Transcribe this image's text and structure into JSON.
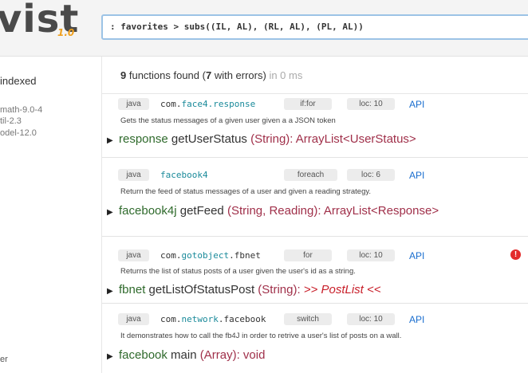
{
  "app": {
    "logo_text": "vist",
    "version": "1.0"
  },
  "query": {
    "value": ": favorites > subs((IL, AL), (RL, AL), (PL, AL))"
  },
  "sidebar": {
    "title": "indexed",
    "libraries": [
      "math-9.0-4",
      "til-2.3",
      "odel-12.0"
    ],
    "footer": "er"
  },
  "summary": {
    "count": "9",
    "text_a": " functions found (",
    "errors": "7",
    "text_b": " with errors)",
    "time": " in 0 ms"
  },
  "results": [
    {
      "lang": "java",
      "pkg_prefix": "com.",
      "pkg_hl": "face4.response",
      "pkg_suffix": "",
      "tag": "if:for",
      "loc": "loc: 10",
      "api": "API",
      "description": "Gets the status messages of a given user given a a JSON token",
      "sig_return": "response",
      "sig_name": " getUserStatus ",
      "sig_params": "(String): ArrayList<UserStatus>",
      "sig_error": "",
      "has_error": false
    },
    {
      "lang": "java",
      "pkg_prefix": "",
      "pkg_hl": "facebook4",
      "pkg_suffix": "",
      "tag": "foreach",
      "loc": "loc: 6",
      "api": "API",
      "description": "Return the feed of status messages of a user and given a reading strategy.",
      "sig_return": "facebook4j",
      "sig_name": " getFeed ",
      "sig_params": "(String, Reading): ArrayList<Response>",
      "sig_error": "",
      "has_error": false
    },
    {
      "lang": "java",
      "pkg_prefix": "com.",
      "pkg_hl": "gotobject",
      "pkg_suffix": ".fbnet",
      "tag": "for",
      "loc": "loc: 10",
      "api": "API",
      "description": "Returns the list of status posts of a user given the user's id as a string.",
      "sig_return": "fbnet",
      "sig_name": " getListOfStatusPost ",
      "sig_params": "(String): ",
      "sig_error": ">> PostList <<",
      "has_error": true
    },
    {
      "lang": "java",
      "pkg_prefix": "com.",
      "pkg_hl": "network",
      "pkg_suffix": ".facebook",
      "tag": "switch",
      "loc": "loc: 10",
      "api": "API",
      "description": "It demonstrates how to call the fb4J in order to retrive a user's list of posts on a wall.",
      "sig_return": "facebook",
      "sig_name": " main ",
      "sig_params": "(Array): void",
      "sig_error": "",
      "has_error": false
    }
  ],
  "icons": {
    "expand": "triangle-right-icon",
    "error": "error-alert-icon"
  },
  "colors": {
    "accent": "#1a6ecf",
    "return_type": "#2f6a2c",
    "params": "#a0304a",
    "error": "#c81f2a",
    "version": "#f0a01e"
  }
}
